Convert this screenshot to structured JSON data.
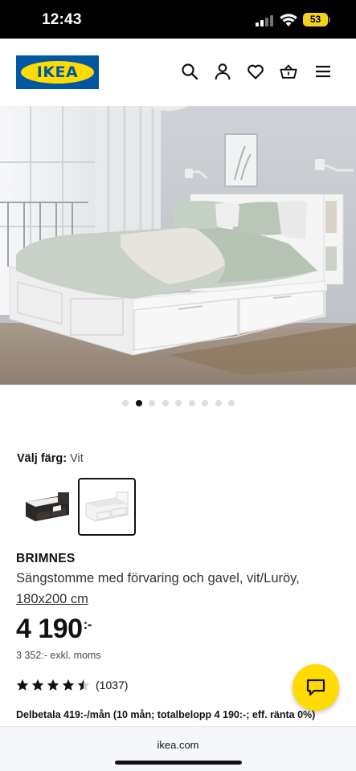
{
  "status_bar": {
    "time": "12:43",
    "battery": "53"
  },
  "header": {
    "logo_text": "IKEA",
    "icons": [
      "search-icon",
      "user-icon",
      "heart-icon",
      "cart-icon",
      "menu-icon"
    ]
  },
  "gallery": {
    "total_images": 9,
    "active_index": 1
  },
  "color_picker": {
    "label": "Välj färg:",
    "value": "Vit",
    "options": [
      {
        "name": "svart-brun",
        "selected": false
      },
      {
        "name": "vit",
        "selected": true
      }
    ]
  },
  "product": {
    "name": "BRIMNES",
    "description": "Sängstomme med förvaring och gavel, vit/Luröy,",
    "size": "180x200 cm",
    "price": "4 190",
    "price_suffix": ":-",
    "price_ex_vat": "3 352:- exkl. moms",
    "rating": 4.5,
    "review_count": "(1037)",
    "installment": "Delbetala 419:-/mån (10 mån; totalbelopp 4 190:-; eff. ränta 0%)"
  },
  "browser": {
    "url": "ikea.com"
  },
  "colors": {
    "brand_blue": "#0058a3",
    "brand_yellow": "#ffdb00"
  }
}
